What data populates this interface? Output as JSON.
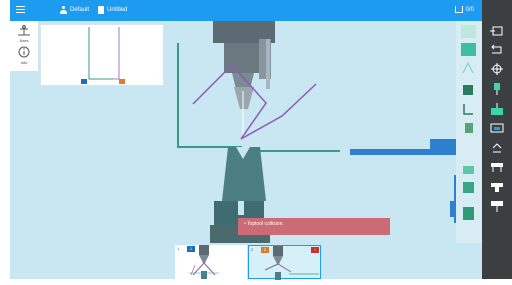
{
  "topbar": {
    "user_label": "Default",
    "file_label": "Untitled",
    "counter": "0/0"
  },
  "left_tools": [
    {
      "name": "axes",
      "label": "Axes"
    },
    {
      "name": "info",
      "label": "Info"
    }
  ],
  "status": {
    "message": "• Toptool collision."
  },
  "sequence": [
    {
      "index": "1",
      "badge": "1",
      "badge_color": "#1d6fb8"
    },
    {
      "index": "2",
      "badge": "2",
      "badge_color": "#e07b2a",
      "warning": "!"
    }
  ],
  "colors": {
    "accent": "#1d9bf0",
    "workspace": "#c9e7f2",
    "tool": "#5b6a73",
    "die": "#4b7f83",
    "part": "#8c5bb5",
    "profile": "#3a9a8a",
    "backgauge": "#2f7fcf",
    "alert": "#cd6b75"
  },
  "icons": [
    "menu-icon",
    "user-icon",
    "file-icon",
    "tool-icon",
    "axes-icon",
    "info-icon"
  ]
}
